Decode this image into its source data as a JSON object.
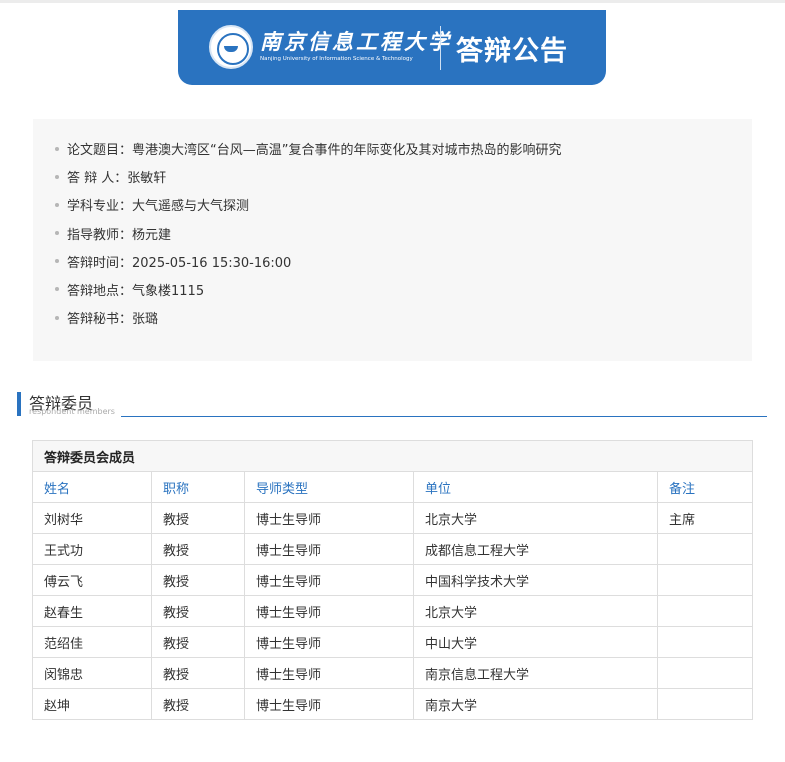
{
  "header": {
    "university_name_cn": "南京信息工程大学",
    "university_name_en": "Nanjing University of Information Science & Technology",
    "title": "答辩公告"
  },
  "info": {
    "items": [
      {
        "label": "论文题目：",
        "value": "粤港澳大湾区“台风—高温”复合事件的年际变化及其对城市热岛的影响研究"
      },
      {
        "label": "答 辩 人：",
        "value": "张敏轩"
      },
      {
        "label": "学科专业：",
        "value": "大气遥感与大气探测"
      },
      {
        "label": "指导教师：",
        "value": "杨元建"
      },
      {
        "label": "答辩时间：",
        "value": "2025-05-16 15:30-16:00"
      },
      {
        "label": "答辩地点：",
        "value": "气象楼1115"
      },
      {
        "label": "答辩秘书：",
        "value": "张璐"
      }
    ]
  },
  "committee_section": {
    "title": "答辩委员",
    "subtitle": "respondent members"
  },
  "members_table": {
    "caption": "答辩委员会成员",
    "columns": [
      "姓名",
      "职称",
      "导师类型",
      "单位",
      "备注"
    ],
    "rows": [
      [
        "刘树华",
        "教授",
        "博士生导师",
        "北京大学",
        "主席"
      ],
      [
        "王式功",
        "教授",
        "博士生导师",
        "成都信息工程大学",
        ""
      ],
      [
        "傅云飞",
        "教授",
        "博士生导师",
        "中国科学技术大学",
        ""
      ],
      [
        "赵春生",
        "教授",
        "博士生导师",
        "北京大学",
        ""
      ],
      [
        "范绍佳",
        "教授",
        "博士生导师",
        "中山大学",
        ""
      ],
      [
        "闵锦忠",
        "教授",
        "博士生导师",
        "南京信息工程大学",
        ""
      ],
      [
        "赵坤",
        "教授",
        "博士生导师",
        "南京大学",
        ""
      ]
    ]
  },
  "colors": {
    "accent": "#2a73c0",
    "info_background": "#f7f7f7",
    "table_border": "#dddddd"
  }
}
